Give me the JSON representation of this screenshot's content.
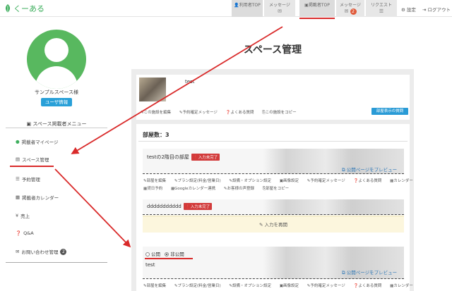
{
  "header": {
    "logo_text": "くーある",
    "tabs": [
      {
        "label": "利用者TOP",
        "icon": "user-icon"
      },
      {
        "label": "メッセージ",
        "icon": "envelope-icon"
      },
      {
        "label": "掲載者TOP",
        "icon": "briefcase-icon"
      },
      {
        "label": "メッセージ",
        "icon": "envelope-icon",
        "badge": "2"
      },
      {
        "label": "リクエスト",
        "icon": "list-icon"
      }
    ],
    "settings_label": "設定",
    "logout_label": "ログアウト"
  },
  "sidebar": {
    "username": "サンプルスペース様",
    "user_info_button": "ユーザ情報",
    "menu_title": "スペース掲載者メニュー",
    "items": [
      {
        "label": "掲載者マイページ",
        "icon": "user-circle-icon"
      },
      {
        "label": "スペース管理",
        "icon": "building-icon"
      },
      {
        "label": "予約管理",
        "icon": "list-icon"
      },
      {
        "label": "掲載者カレンダー",
        "icon": "calendar-icon"
      },
      {
        "label": "売上",
        "icon": "yen-icon"
      },
      {
        "label": "Q&A",
        "icon": "question-icon"
      },
      {
        "label": "お問い合わせ管理",
        "icon": "envelope-icon",
        "badge": "2"
      }
    ]
  },
  "main": {
    "title": "スペース管理",
    "space": {
      "name": "test",
      "links": [
        "この施設を編集",
        "予約確定メッセージ",
        "よくある質問",
        "この施設をコピー"
      ],
      "button": "部屋表示の質問"
    },
    "rooms_count_label": "部屋数：3",
    "rooms": [
      {
        "name": "testの2階目の部屋",
        "status": "入力未完了",
        "preview": "公開ページをプレビュー",
        "links_row1": [
          "部屋を編集",
          "プラン設定(料金/営業日)",
          "設備・オプション設定",
          "画像設定",
          "予約確定メッセージ",
          "よくある質問",
          "カレンダー"
        ],
        "links_row2": [
          "貸日予約",
          "Googleカレンダー連携",
          "お客様の声登録",
          "部屋をコピー"
        ]
      },
      {
        "name": "ddddddddddd",
        "status": "入力未完了",
        "notice": "入力を再開"
      },
      {
        "name": "test",
        "visibility_options": [
          "公開",
          "非公開"
        ],
        "visibility_selected": "非公開",
        "preview": "公開ページをプレビュー",
        "links_row1": [
          "部屋を編集",
          "プラン設定(料金/営業日)",
          "設備・オプション設定",
          "画像設定",
          "予約確定メッセージ",
          "よくある質問",
          "カレンダー"
        ]
      }
    ]
  },
  "colors": {
    "brand_green": "#3cae5c",
    "accent_blue": "#29a0d8",
    "annotation_red": "#d92a2a",
    "status_red": "#d23b3b"
  }
}
